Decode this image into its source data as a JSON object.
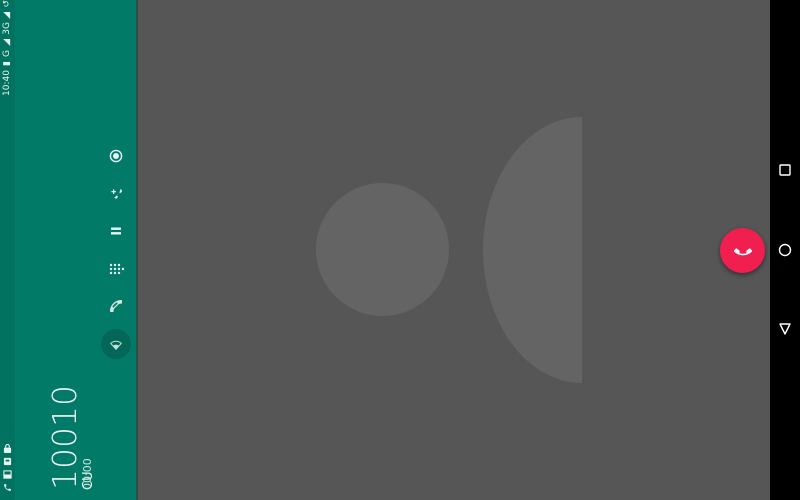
{
  "status_bar": {
    "time": "10:40",
    "network_labels": [
      "3G",
      "G"
    ],
    "icons": [
      "call-forward-icon",
      "signal-icon",
      "battery-icon",
      "lock-icon",
      "notification-icon",
      "sim-icon",
      "phone-icon"
    ]
  },
  "call": {
    "carrier_label": "CU",
    "number": "10010",
    "duration": "00:00"
  },
  "actions": [
    {
      "name": "record-icon",
      "active": false
    },
    {
      "name": "add-call-icon",
      "active": false
    },
    {
      "name": "hold-icon",
      "active": false
    },
    {
      "name": "dialpad-icon",
      "active": false
    },
    {
      "name": "mute-icon",
      "active": false
    },
    {
      "name": "speaker-icon",
      "active": true
    }
  ],
  "end_call": {
    "icon": "end-call-icon",
    "color": "#f11e50"
  },
  "nav": [
    "recents-icon",
    "home-icon",
    "back-icon"
  ],
  "colors": {
    "panel": "#027a68",
    "status_bar": "#00725f",
    "background": "#565656",
    "avatar": "#646464"
  }
}
